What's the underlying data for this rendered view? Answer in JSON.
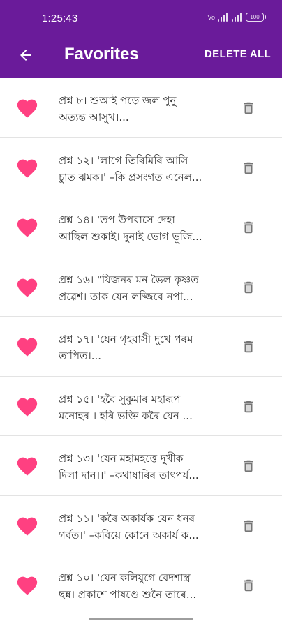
{
  "status_bar": {
    "time": "1:25:43",
    "volte_label": "Vo",
    "battery_label": "100"
  },
  "app_bar": {
    "title": "Favorites",
    "back_icon": "arrow-left-icon",
    "delete_all_label": "DELETE ALL"
  },
  "colors": {
    "primary": "#6a1b9a",
    "heart": "#ff4081",
    "trash": "#757575"
  },
  "favorites": [
    {
      "line1": "প্ৰশ্ন ৮। শুআই পড়ে জল পুনু",
      "line2": "অত্যন্ত আসুখ।..."
    },
    {
      "line1": "প্ৰশ্ন ১২। 'লাগে তিৰিমিৰি আসি",
      "line2": "চুাত ঝমক।' –কি প্ৰসংগত এনেল..."
    },
    {
      "line1": "প্ৰশ্ন ১৪। 'তপ উপবাসে দেহা",
      "line2": "আছিল শুকাই। দুনাই ভোগ ভূজি..."
    },
    {
      "line1": "প্ৰশ্ন ১৬। \"যিজনৰ মন ভৈল কৃষ্ণত",
      "line2": "প্ৰৱেশ। তাক যেন লজ্জিবে নপা..."
    },
    {
      "line1": "প্ৰশ্ন ১৭। 'যেন গৃহবাসী দুখে পৰম",
      "line2": "তাপিত।..."
    },
    {
      "line1": "প্ৰশ্ন ১৫। 'হবৈ সুকুমাৰ মহাৰূপ",
      "line2": "মনোহৰ । হৰি ভক্তি কৰৈ যেন ..."
    },
    {
      "line1": "প্ৰশ্ন ১৩। 'যেন মহামহত্তে দুখীক",
      "line2": "দিলা দান।।' –কথাষাৰিৰ তাৎপৰ্য..."
    },
    {
      "line1": "প্ৰশ্ন ১১। 'কৰৈ অকাৰ্যক যেন ধনৰ",
      "line2": "গৰ্বত।' –কবিয়ে কোনে অকাৰ্য ক..."
    },
    {
      "line1": "প্ৰশ্ন ১০। 'যেন কলিযুগে বেদশাস্ত্ৰ",
      "line2": "ছন্ন। প্ৰকাশে পাষণ্ডে শুনৈ তাৰে..."
    }
  ]
}
